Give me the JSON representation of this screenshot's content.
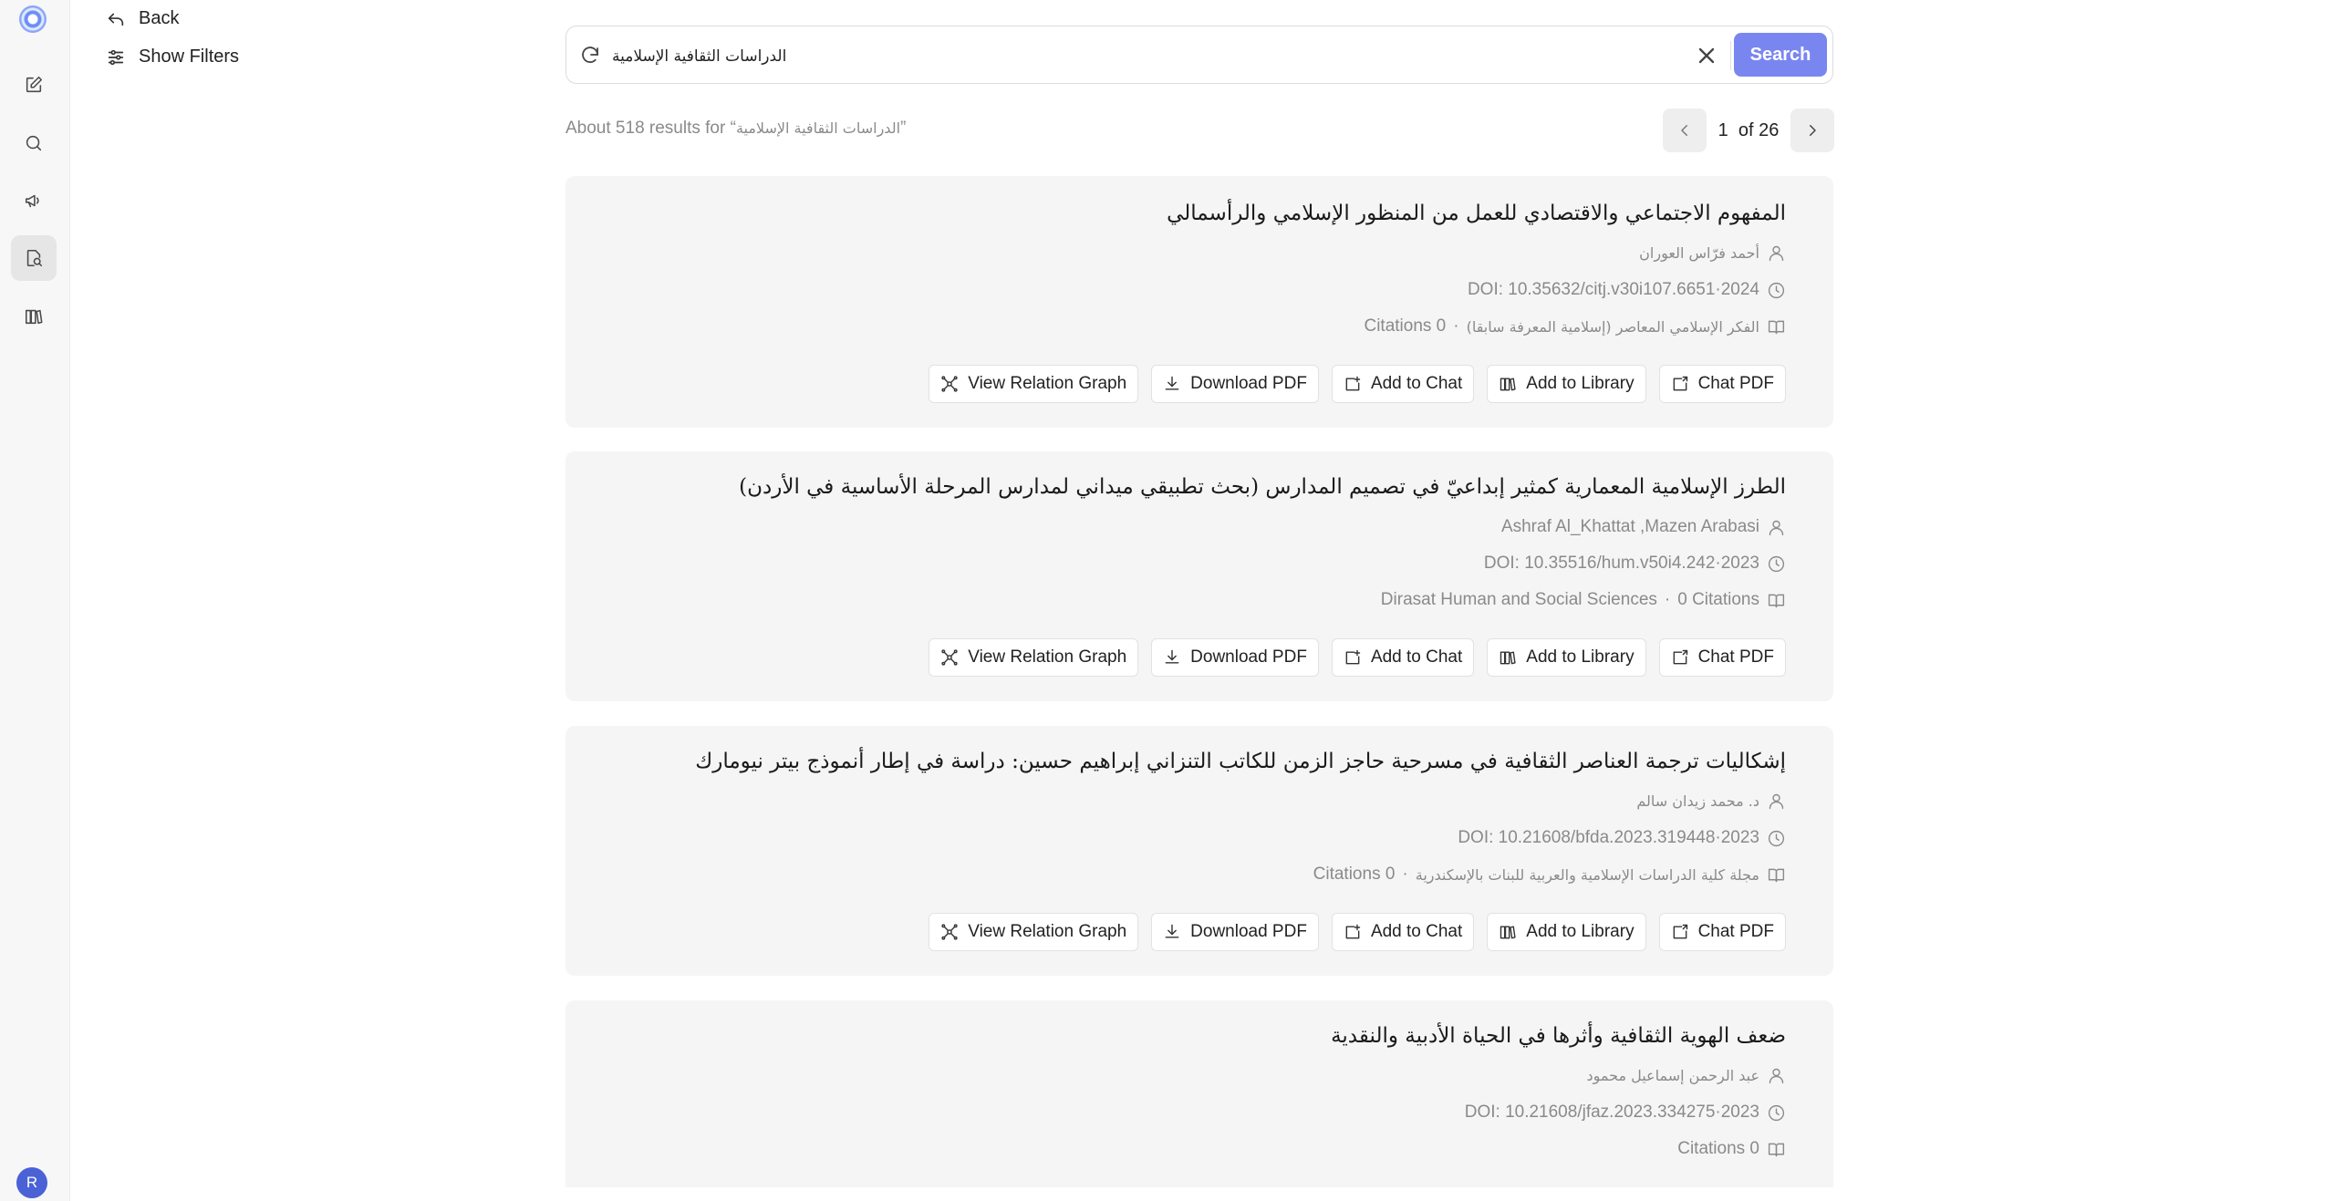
{
  "nav": {
    "back_label": "Back",
    "filters_label": "Show Filters"
  },
  "rail": {
    "avatar_initial": "R"
  },
  "search": {
    "query": "الدراسات الثقافية الإسلامية",
    "button_label": "Search"
  },
  "results_info": {
    "prefix": "About 518 results for “",
    "query": "الدراسات الثقافية الإسلامية",
    "suffix": "”"
  },
  "pagination": {
    "current": "1",
    "of_label": "of",
    "total": "26"
  },
  "actions": {
    "view_graph": "View Relation Graph",
    "download_pdf": "Download PDF",
    "add_to_chat": "Add to Chat",
    "add_to_library": "Add to Library",
    "chat_pdf": "Chat PDF"
  },
  "results": [
    {
      "title": "المفهوم الاجتماعي والاقتصادي للعمل من المنظور الإسلامي والرأسمالي",
      "authors": "أحمد فرّاس العوران",
      "doi_year": "DOI: 10.35632/citj.v30i107.6651·2024",
      "journal": "الفكر الإسلامي المعاصر (إسلامية المعرفة سابقا)",
      "citations": "Citations 0"
    },
    {
      "title": "الطرز الإسلامية المعمارية كمثير إبداعيّ في تصميم المدارس (بحث تطبيقي ميداني لمدارس المرحلة الأساسية في الأردن)",
      "authors": "Ashraf Al_Khattat ,Mazen Arabasi",
      "doi_year": "DOI: 10.35516/hum.v50i4.242·2023",
      "journal": "Dirasat Human and Social Sciences",
      "citations": "0 Citations"
    },
    {
      "title": "إشكاليات ترجمة العناصر الثقافية في مسرحية حاجز الزمن للكاتب التنزاني إبراهيم حسين: دراسة في إطار أنموذج بيتر نيومارك",
      "authors": "د. محمد زيدان سالم",
      "doi_year": "DOI: 10.21608/bfda.2023.319448·2023",
      "journal": "مجلة كلية الدراسات الإسلامية والعربية للبنات بالإسكندرية",
      "citations": "Citations 0"
    },
    {
      "title": "ضعف الهوية الثقافية وأثرها في الحياة الأدبية والنقدية",
      "authors": "عبد الرحمن إسماعيل محمود",
      "doi_year": "DOI: 10.21608/jfaz.2023.334275·2023",
      "journal": "",
      "citations": "Citations 0"
    }
  ]
}
